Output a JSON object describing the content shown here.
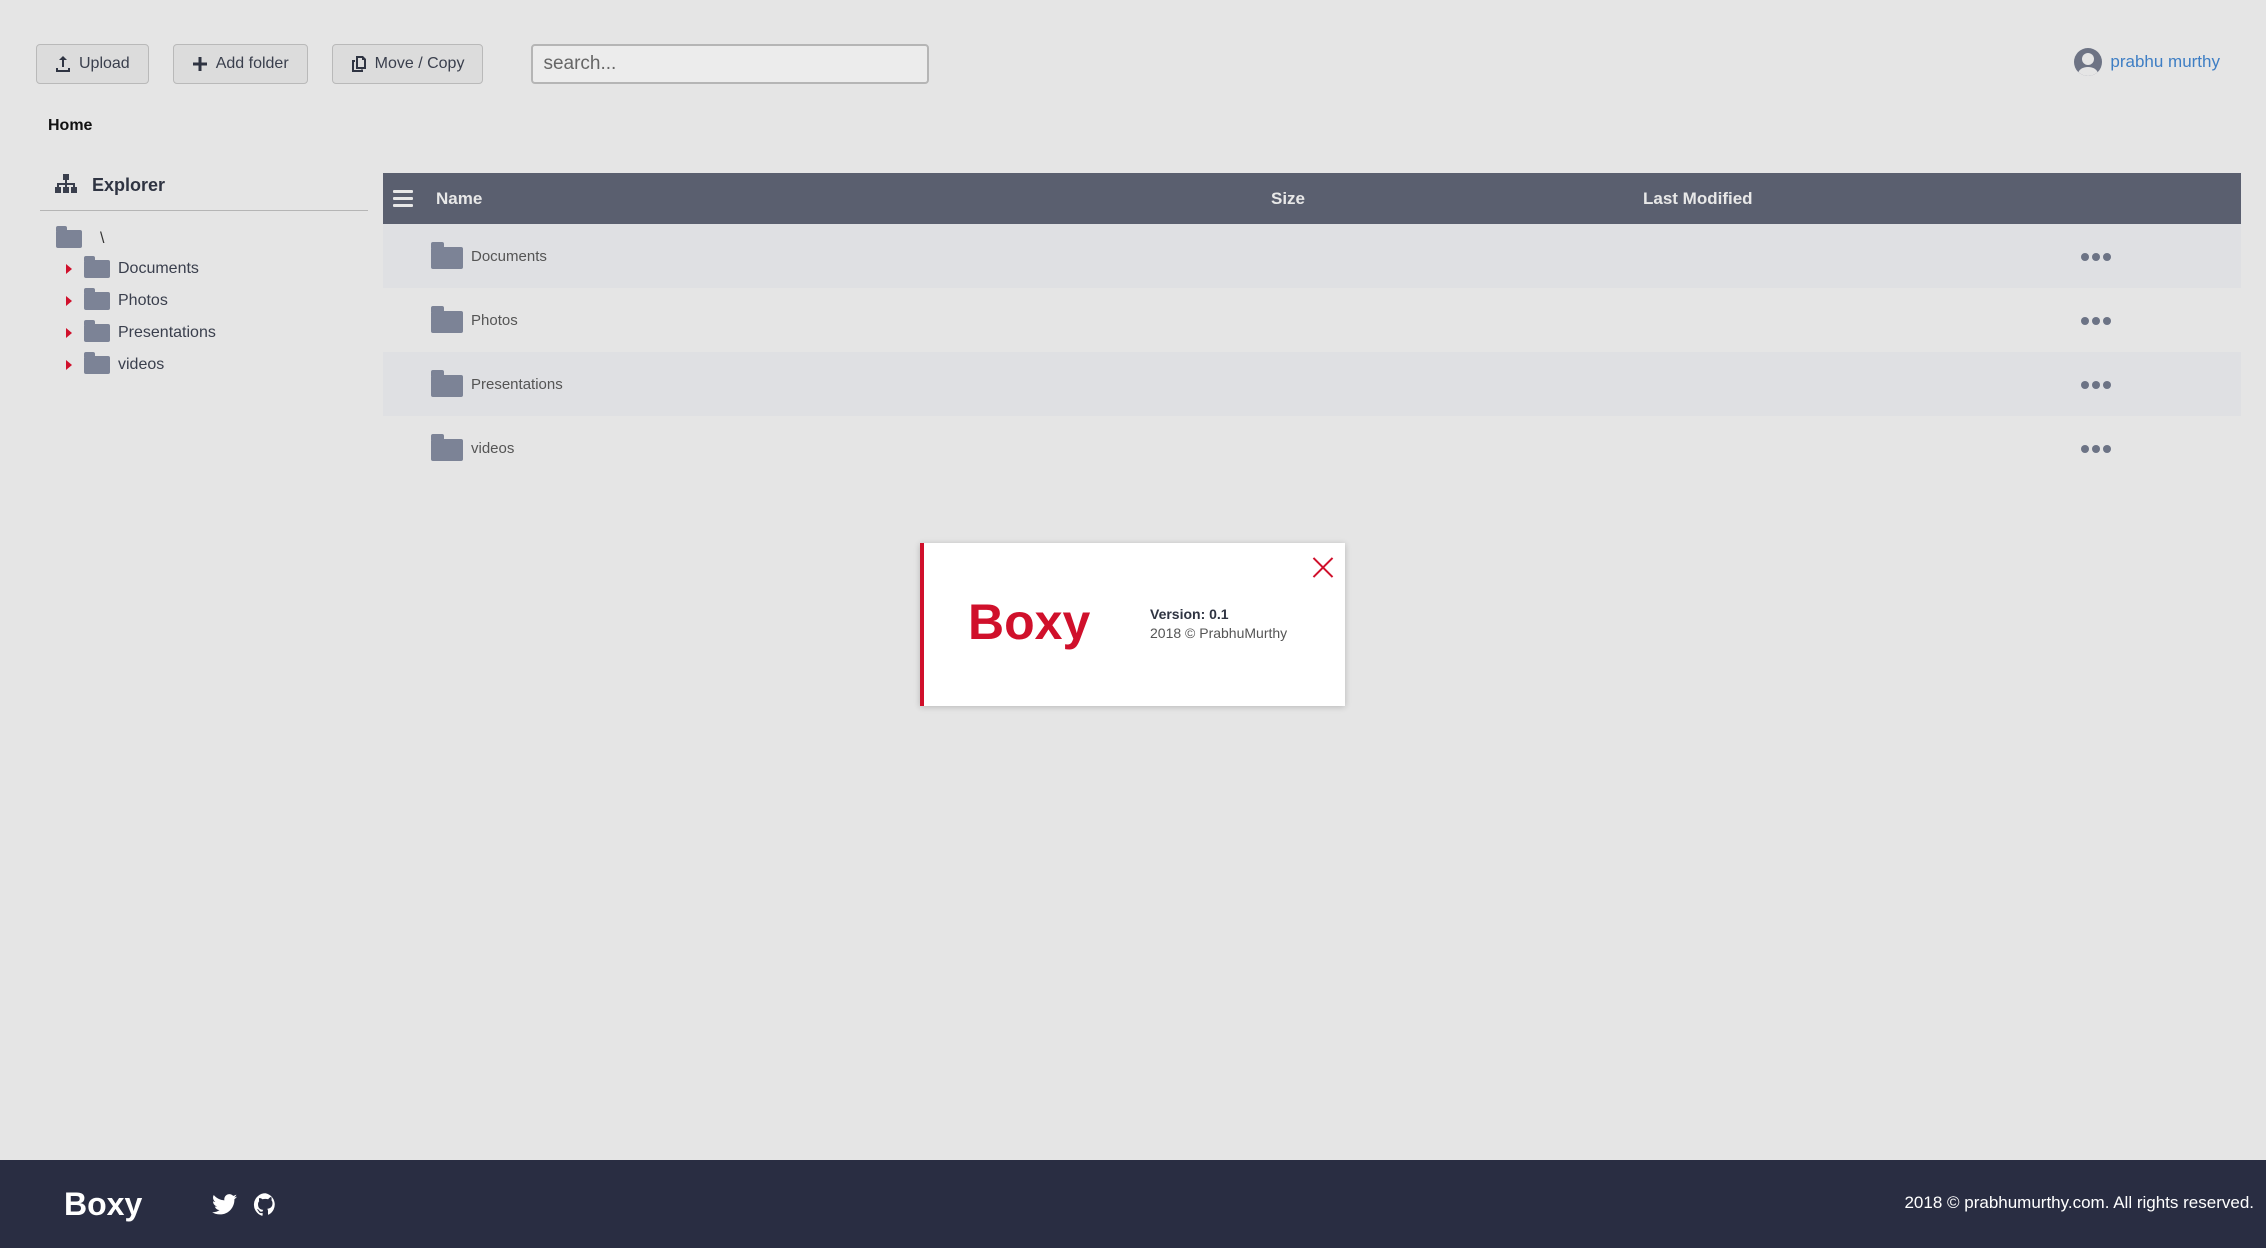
{
  "toolbar": {
    "upload_label": "Upload",
    "add_folder_label": "Add folder",
    "move_copy_label": "Move / Copy"
  },
  "search": {
    "placeholder": "search...",
    "value": ""
  },
  "user": {
    "name": "prabhu murthy"
  },
  "breadcrumb": {
    "current": "Home"
  },
  "sidebar": {
    "title": "Explorer",
    "root": "\\",
    "items": [
      {
        "label": "Documents"
      },
      {
        "label": "Photos"
      },
      {
        "label": "Presentations"
      },
      {
        "label": "videos"
      }
    ]
  },
  "table": {
    "columns": {
      "name": "Name",
      "size": "Size",
      "modified": "Last Modified"
    },
    "rows": [
      {
        "name": "Documents",
        "size": "",
        "modified": ""
      },
      {
        "name": "Photos",
        "size": "",
        "modified": ""
      },
      {
        "name": "Presentations",
        "size": "",
        "modified": ""
      },
      {
        "name": "videos",
        "size": "",
        "modified": ""
      }
    ]
  },
  "modal": {
    "brand": "Boxy",
    "version": "Version: 0.1",
    "copyright": "2018 © PrabhuMurthy"
  },
  "footer": {
    "brand": "Boxy",
    "copyright": "2018 © prabhumurthy.com. All rights reserved.",
    "social_icons": [
      "twitter-icon",
      "github-icon"
    ]
  },
  "colors": {
    "accent": "#d0102b",
    "header_bg": "#5a5f6f",
    "footer_bg": "#292d42",
    "link": "#3e7ec4"
  }
}
